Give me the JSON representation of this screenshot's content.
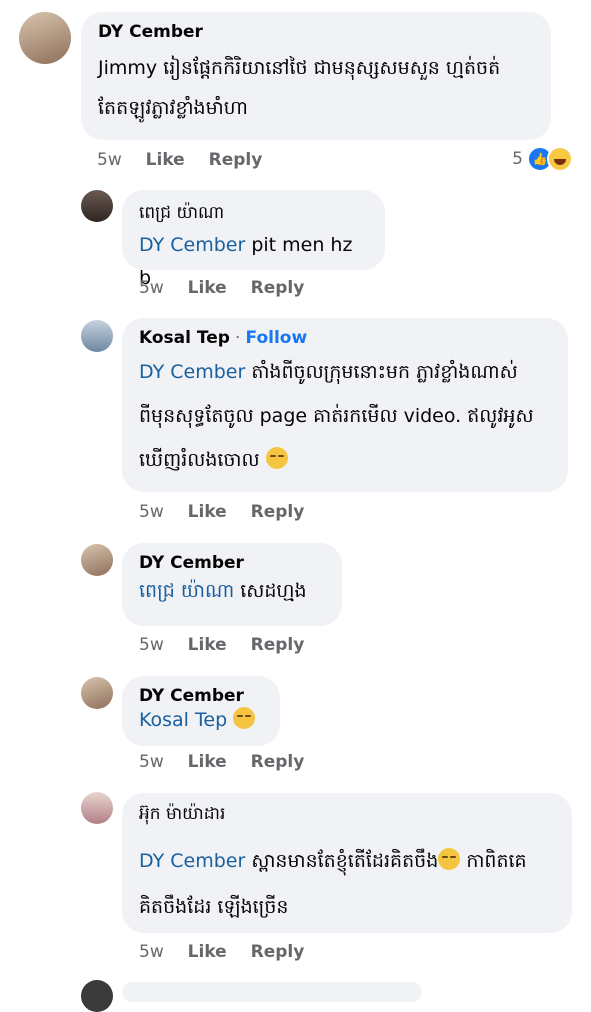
{
  "comments": [
    {
      "author": "DY Cember",
      "text": "Jimmy រៀនផ្ដែកកិរិយានៅថៃ ជាមនុស្សសមសួន ហ្មត់ចត់ តែតឡូវភ្លាវខ្លាំងមាំហា",
      "time": "5w",
      "like": "Like",
      "reply": "Reply",
      "reaction_count": "5"
    },
    {
      "author": "ពេជ្រ យ៉ាណា",
      "mention": "DY Cember",
      "text": "pit men hz b",
      "time": "5w",
      "like": "Like",
      "reply": "Reply"
    },
    {
      "author": "Kosal Tep",
      "follow": "Follow",
      "mention": "DY Cember",
      "text_line1": "តាំងពីចូលក្រុមនោះមក ភ្លាវខ្លាំងណាស់",
      "text_line2": "ពីមុនសុទ្ធតែចូល page គាត់រកមើល video. ឥលូវអូស",
      "text_line3": "ឃើញរំលងចោល",
      "time": "5w",
      "like": "Like",
      "reply": "Reply"
    },
    {
      "author": "DY Cember",
      "mention": "ពេជ្រ យ៉ាណា",
      "text": "សេដហ្មង",
      "time": "5w",
      "like": "Like",
      "reply": "Reply"
    },
    {
      "author": "DY Cember",
      "mention": "Kosal Tep",
      "text": "",
      "time": "5w",
      "like": "Like",
      "reply": "Reply"
    },
    {
      "author": "អ៊ុក ម៉ាយ៉ាដារ",
      "mention": "DY Cember",
      "text_line1": "ស្ពានមានតែខ្ញុំតើដែរគិតចឹង",
      "text_line1b": "កាពិតគេ",
      "text_line2": "គិតចឹងដែរ ឡើងច្រើន",
      "time": "5w",
      "like": "Like",
      "reply": "Reply"
    }
  ],
  "colors": {
    "bubble": "#f0f2f5",
    "mention": "#1a5fa0",
    "follow": "#1877f2",
    "meta": "#65676b"
  }
}
